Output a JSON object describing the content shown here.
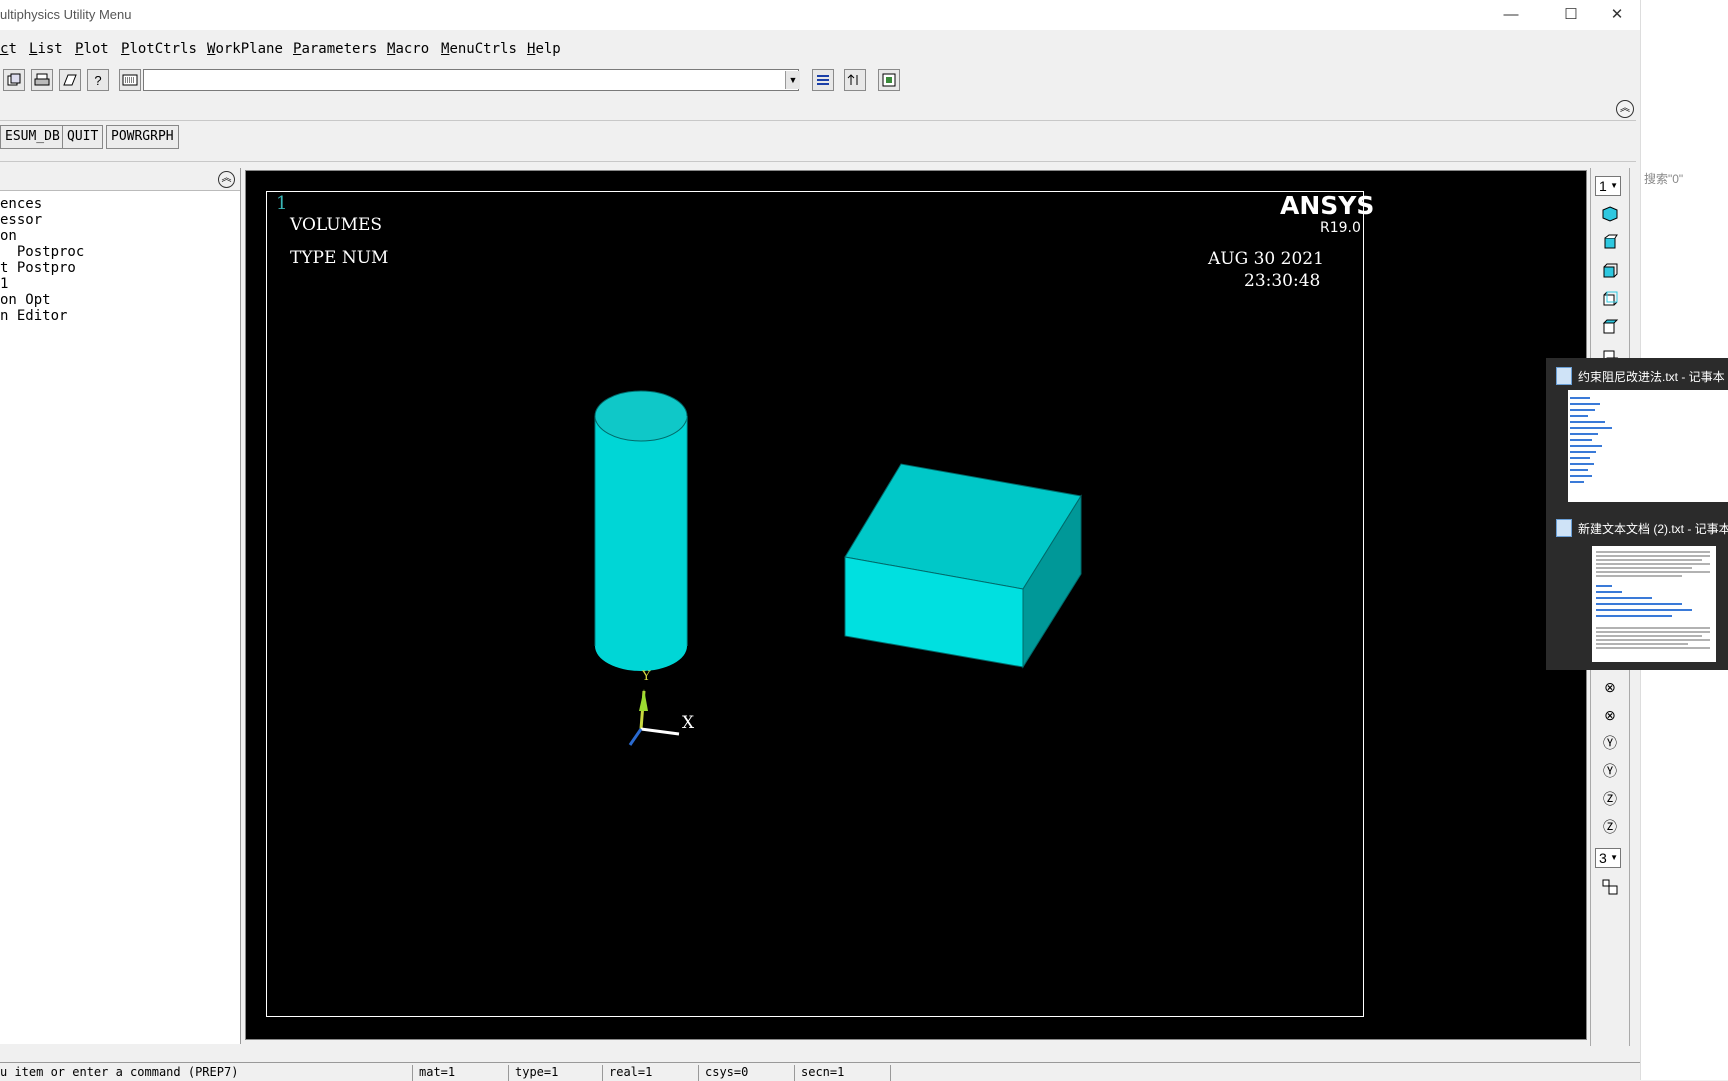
{
  "window": {
    "title": "ultiphysics Utility Menu",
    "controls": [
      "—",
      "☐",
      "✕"
    ]
  },
  "menubar": {
    "items": [
      "ct",
      "List",
      "Plot",
      "PlotCtrls",
      "WorkPlane",
      "Parameters",
      "Macro",
      "MenuCtrls",
      "Help"
    ]
  },
  "toolbar": {
    "command_value": ""
  },
  "quickbar": {
    "buttons": [
      "ESUM_DB",
      "QUIT",
      "POWRGRPH"
    ]
  },
  "tree": {
    "items": [
      "ences",
      "essor",
      "on",
      "  Postproc",
      "t Postpro",
      "1",
      "on Opt",
      "n Editor"
    ]
  },
  "graphics": {
    "window_number": "1",
    "label_1": "VOLUMES",
    "label_2": "TYPE NUM",
    "brand": "ANSYS",
    "version": "R19.0",
    "date": "AUG 30 2021",
    "time": "23:30:48",
    "axis_y": "Y",
    "axis_x": "X",
    "model_color": "#00e5e5"
  },
  "right_toolbar": {
    "window_select": "1",
    "rate_select": "3"
  },
  "desktop": {
    "search_hint": "搜索\"0\"",
    "thumb_1_title": "约束阻尼改进法.txt - 记事本",
    "thumb_2_title": "新建文本文档 (2).txt - 记事本"
  },
  "statusbar": {
    "prompt": "u item or enter a command (PREP7)",
    "mat": "mat=1",
    "type": "type=1",
    "real": "real=1",
    "csys": "csys=0",
    "secn": "secn=1"
  }
}
